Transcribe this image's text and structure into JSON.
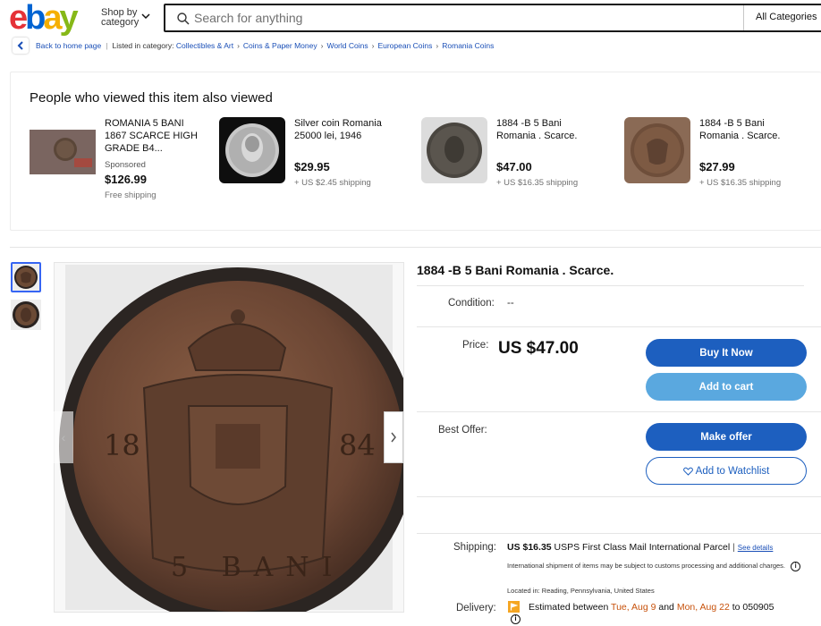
{
  "header": {
    "logo_letters": [
      {
        "ch": "e",
        "color": "#e53238"
      },
      {
        "ch": "b",
        "color": "#0064d2"
      },
      {
        "ch": "a",
        "color": "#f5af02"
      },
      {
        "ch": "y",
        "color": "#86b817"
      }
    ],
    "shop_by": "Shop by category",
    "search_placeholder": "Search for anything",
    "category_select": "All Categories"
  },
  "breadcrumb": {
    "back_label": "Back to home page",
    "listed_in": "Listed in category:",
    "items": [
      "Collectibles & Art",
      "Coins & Paper Money",
      "World Coins",
      "European Coins",
      "Romania Coins"
    ]
  },
  "also_viewed": {
    "title": "People who viewed this item also viewed",
    "items": [
      {
        "title": "ROMANIA 5 BANI 1867 SCARCE HIGH GRADE B4...",
        "sponsored": "Sponsored",
        "price": "$126.99",
        "shipping": "Free shipping"
      },
      {
        "title": "Silver coin Romania 25000 lei, 1946",
        "sponsored": "",
        "price": "$29.95",
        "shipping": "+ US $2.45 shipping"
      },
      {
        "title": "1884 -B 5 Bani Romania . Scarce.",
        "sponsored": "",
        "price": "$47.00",
        "shipping": "+ US $16.35 shipping"
      },
      {
        "title": "1884 -B 5 Bani Romania . Scarce.",
        "sponsored": "",
        "price": "$27.99",
        "shipping": "+ US $16.35 shipping"
      }
    ]
  },
  "item": {
    "title": "1884 -B 5 Bani Romania . Scarce.",
    "condition_label": "Condition:",
    "condition_value": "--",
    "price_label": "Price:",
    "price": "US $47.00",
    "buy_now": "Buy It Now",
    "add_to_cart": "Add to cart",
    "best_offer_label": "Best Offer:",
    "make_offer": "Make offer",
    "add_to_watchlist": "Add to Watchlist",
    "shipping_label": "Shipping:",
    "shipping_cost": "US $16.35",
    "shipping_service": "USPS First Class Mail International Parcel",
    "see_details": "See details",
    "shipping_note": "International shipment of items may be subject to customs processing and additional charges.",
    "located": "Located in: Reading, Pennsylvania, United States",
    "delivery_label": "Delivery:",
    "delivery_prefix": "Estimated between",
    "delivery_start": "Tue, Aug 9",
    "delivery_and": "and",
    "delivery_end": "Mon, Aug 22",
    "delivery_to": "to 050905",
    "coin_year_left": "18",
    "coin_year_right": "84",
    "coin_denom": "5 BANI"
  },
  "colors": {
    "primary_button": "#1d5fbf",
    "secondary_button": "#5aa8df",
    "link": "#1a4fb7",
    "date_highlight": "#c7520c"
  }
}
